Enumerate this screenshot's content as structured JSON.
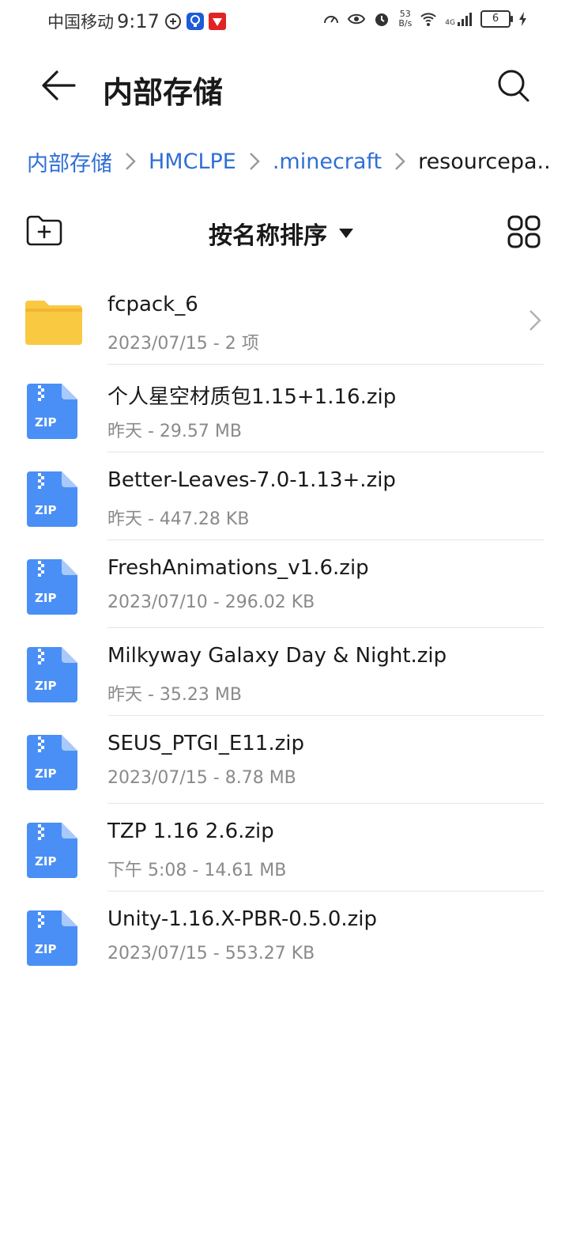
{
  "status_bar": {
    "carrier": "中国移动",
    "time": "9:17",
    "net_speed_value": "53",
    "net_speed_unit": "B/s",
    "network": "4G",
    "battery": "6"
  },
  "header": {
    "title": "内部存储"
  },
  "breadcrumb": [
    "内部存储",
    "HMCLPE",
    ".minecraft",
    "resourcepa..."
  ],
  "toolbar": {
    "sort_label": "按名称排序"
  },
  "colors": {
    "accent": "#2f6fd6",
    "folder": "#f9c942",
    "zip": "#4a8ff5"
  },
  "files": [
    {
      "name": "fcpack_6",
      "meta": "2023/07/15 - 2 项",
      "type": "folder"
    },
    {
      "name": "个人星空材质包1.15+1.16.zip",
      "meta": "昨天 - 29.57 MB",
      "type": "zip"
    },
    {
      "name": "Better-Leaves-7.0-1.13+.zip",
      "meta": "昨天 - 447.28 KB",
      "type": "zip"
    },
    {
      "name": "FreshAnimations_v1.6.zip",
      "meta": "2023/07/10 - 296.02 KB",
      "type": "zip"
    },
    {
      "name": "Milkyway Galaxy Day & Night.zip",
      "meta": "昨天 - 35.23 MB",
      "type": "zip"
    },
    {
      "name": "SEUS_PTGI_E11.zip",
      "meta": "2023/07/15 - 8.78 MB",
      "type": "zip"
    },
    {
      "name": "TZP 1.16 2.6.zip",
      "meta": "下午 5:08  - 14.61 MB",
      "type": "zip"
    },
    {
      "name": "Unity-1.16.X-PBR-0.5.0.zip",
      "meta": "2023/07/15 - 553.27 KB",
      "type": "zip"
    }
  ],
  "zip_label": "ZIP"
}
